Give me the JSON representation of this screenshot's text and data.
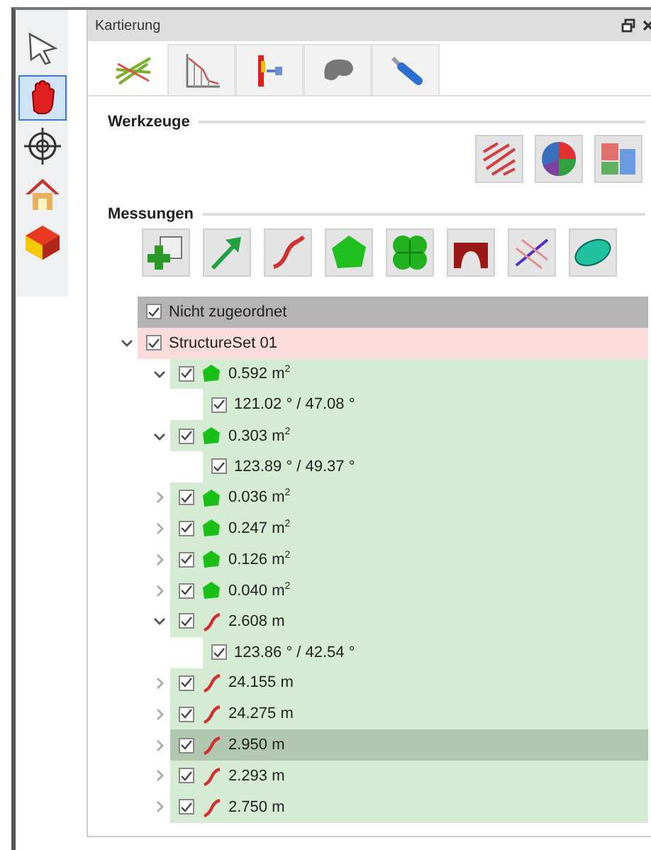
{
  "side_toolbar": [
    {
      "kind": "pointer",
      "selected": false
    },
    {
      "kind": "hand",
      "selected": true
    },
    {
      "kind": "crosshair",
      "selected": false
    },
    {
      "kind": "house",
      "selected": false
    },
    {
      "kind": "cube",
      "selected": false
    }
  ],
  "panel": {
    "title": "Kartierung"
  },
  "tabs": [
    {
      "kind": "lines",
      "selected": true
    },
    {
      "kind": "chart",
      "selected": false
    },
    {
      "kind": "profile",
      "selected": false
    },
    {
      "kind": "blob",
      "selected": false
    },
    {
      "kind": "tool",
      "selected": false
    }
  ],
  "sections": [
    {
      "title": "Werkzeuge",
      "kind": "tools"
    },
    {
      "title": "Messungen",
      "kind": "measurements"
    }
  ],
  "tree": [
    {
      "label": "Nicht zugeordnet",
      "color": "#b4b4b4",
      "checked": true,
      "selected": false
    },
    {
      "label": "StructureSet 01",
      "color": "#fbdcdc",
      "checked": true,
      "selected": false,
      "expanded": true,
      "children": [
        {
          "label": "0.592 m$^{2}$",
          "kind": "area",
          "checked": true,
          "selected": false,
          "expanded": true,
          "children": [
            {
              "label": "121.02 ° / 47.08 °",
              "kind": "angle",
              "checked": true,
              "selected": false
            }
          ]
        },
        {
          "label": "0.303 m$^{2}$",
          "kind": "area",
          "checked": true,
          "selected": false,
          "expanded": true,
          "children": [
            {
              "label": "123.89 ° / 49.37 °",
              "kind": "angle",
              "checked": true,
              "selected": false
            }
          ]
        },
        {
          "label": "0.036 m$^{2}$",
          "kind": "area",
          "checked": true,
          "selected": false,
          "expanded": false
        },
        {
          "label": "0.247 m$^{2}$",
          "kind": "area",
          "checked": true,
          "selected": false,
          "expanded": false
        },
        {
          "label": "0.126 m$^{2}$",
          "kind": "area",
          "checked": true,
          "selected": false,
          "expanded": false
        },
        {
          "label": "0.040 m$^{2}$",
          "kind": "area",
          "checked": true,
          "selected": false,
          "expanded": false
        },
        {
          "label": "2.608 m",
          "kind": "line",
          "checked": true,
          "selected": false,
          "expanded": true,
          "children": [
            {
              "label": "123.86 ° / 42.54 °",
              "kind": "angle",
              "checked": true,
              "selected": false
            }
          ]
        },
        {
          "label": "24.155 m",
          "kind": "line",
          "checked": true,
          "selected": false,
          "expanded": false
        },
        {
          "label": "24.275 m",
          "kind": "line",
          "checked": true,
          "selected": false,
          "expanded": false
        },
        {
          "label": "2.950 m",
          "kind": "line",
          "checked": true,
          "selected": true,
          "expanded": false
        },
        {
          "label": "2.293 m",
          "kind": "line",
          "checked": true,
          "selected": false,
          "expanded": false
        },
        {
          "label": "2.750 m",
          "kind": "line",
          "checked": true,
          "selected": false,
          "expanded": false
        }
      ]
    }
  ]
}
